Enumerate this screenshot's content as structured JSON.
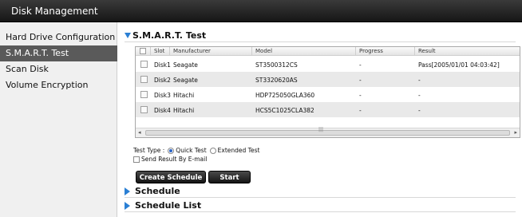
{
  "window": {
    "title": "Disk Management"
  },
  "sidebar": {
    "items": [
      {
        "label": "Hard Drive Configuration"
      },
      {
        "label": "S.M.A.R.T. Test"
      },
      {
        "label": "Scan Disk"
      },
      {
        "label": "Volume Encryption"
      }
    ]
  },
  "smart": {
    "title": "S.M.A.R.T. Test",
    "columns": [
      "Slot",
      "Manufacturer",
      "Model",
      "Progress",
      "Result"
    ],
    "rows": [
      {
        "slot": "Disk1",
        "manufacturer": "Seagate",
        "model": "ST3500312CS",
        "progress": "-",
        "result": "Pass[2005/01/01 04:03:42]"
      },
      {
        "slot": "Disk2",
        "manufacturer": "Seagate",
        "model": "ST3320620AS",
        "progress": "-",
        "result": "-"
      },
      {
        "slot": "Disk3",
        "manufacturer": "Hitachi",
        "model": "HDP725050GLA360",
        "progress": "-",
        "result": "-"
      },
      {
        "slot": "Disk4",
        "manufacturer": "Hitachi",
        "model": "HCS5C1025CLA382",
        "progress": "-",
        "result": "-"
      }
    ],
    "test_type_label": "Test Type :",
    "quick_test_label": "Quick Test",
    "extended_test_label": "Extended Test",
    "send_result_label": "Send Result By E-mail",
    "create_schedule_label": "Create Schedule",
    "start_label": "Start"
  },
  "schedule": {
    "title": "Schedule"
  },
  "schedule_list": {
    "title": "Schedule List"
  },
  "icons": {
    "expanded": "triangle-down-icon",
    "collapsed": "triangle-right-icon",
    "scroll_left": "arrow-left-icon",
    "scroll_right": "arrow-right-icon"
  },
  "colors": {
    "accent": "#2a7fd4",
    "titlebar": "#1e1e1e",
    "selected": "#5a5a5a"
  }
}
